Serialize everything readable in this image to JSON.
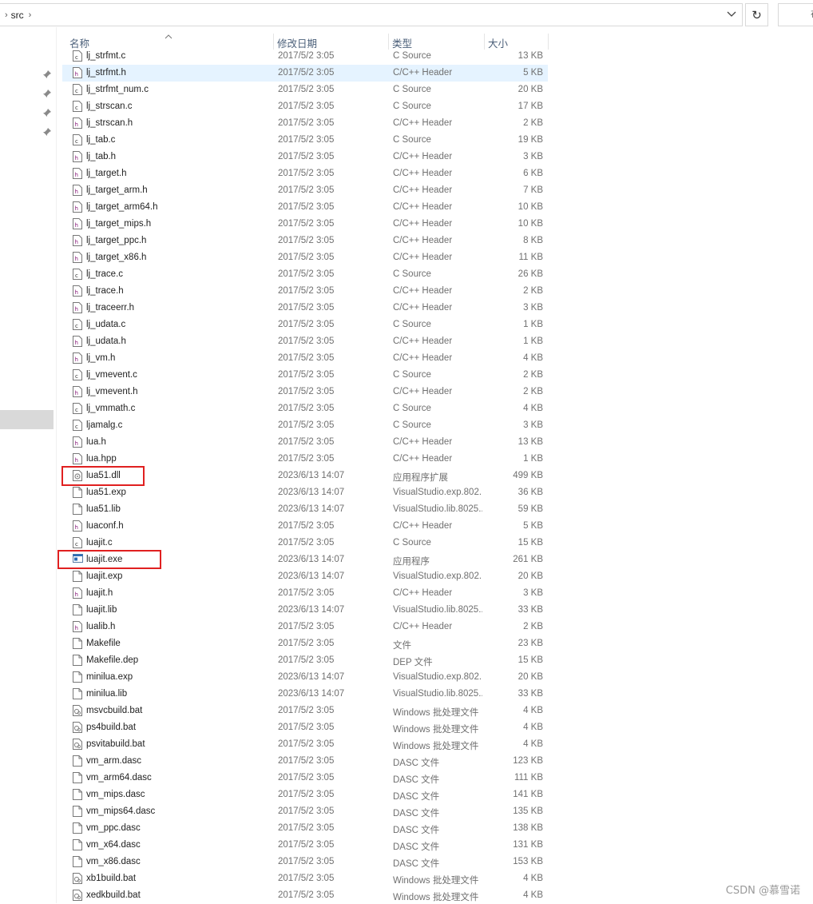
{
  "address": {
    "crumbs": [
      "src"
    ]
  },
  "refresh_label": "↻",
  "search_partial": "在",
  "columns": {
    "name": "名称",
    "date": "修改日期",
    "type": "类型",
    "size": "大小"
  },
  "files": [
    {
      "name": "lj_strfmt.c",
      "date": "2017/5/2 3:05",
      "type": "C Source",
      "size": "13 KB",
      "icon": "c-file-icon"
    },
    {
      "name": "lj_strfmt.h",
      "date": "2017/5/2 3:05",
      "type": "C/C++ Header",
      "size": "5 KB",
      "icon": "h-file-icon",
      "selected": true
    },
    {
      "name": "lj_strfmt_num.c",
      "date": "2017/5/2 3:05",
      "type": "C Source",
      "size": "20 KB",
      "icon": "c-file-icon"
    },
    {
      "name": "lj_strscan.c",
      "date": "2017/5/2 3:05",
      "type": "C Source",
      "size": "17 KB",
      "icon": "c-file-icon"
    },
    {
      "name": "lj_strscan.h",
      "date": "2017/5/2 3:05",
      "type": "C/C++ Header",
      "size": "2 KB",
      "icon": "h-file-icon"
    },
    {
      "name": "lj_tab.c",
      "date": "2017/5/2 3:05",
      "type": "C Source",
      "size": "19 KB",
      "icon": "c-file-icon"
    },
    {
      "name": "lj_tab.h",
      "date": "2017/5/2 3:05",
      "type": "C/C++ Header",
      "size": "3 KB",
      "icon": "h-file-icon"
    },
    {
      "name": "lj_target.h",
      "date": "2017/5/2 3:05",
      "type": "C/C++ Header",
      "size": "6 KB",
      "icon": "h-file-icon"
    },
    {
      "name": "lj_target_arm.h",
      "date": "2017/5/2 3:05",
      "type": "C/C++ Header",
      "size": "7 KB",
      "icon": "h-file-icon"
    },
    {
      "name": "lj_target_arm64.h",
      "date": "2017/5/2 3:05",
      "type": "C/C++ Header",
      "size": "10 KB",
      "icon": "h-file-icon"
    },
    {
      "name": "lj_target_mips.h",
      "date": "2017/5/2 3:05",
      "type": "C/C++ Header",
      "size": "10 KB",
      "icon": "h-file-icon"
    },
    {
      "name": "lj_target_ppc.h",
      "date": "2017/5/2 3:05",
      "type": "C/C++ Header",
      "size": "8 KB",
      "icon": "h-file-icon"
    },
    {
      "name": "lj_target_x86.h",
      "date": "2017/5/2 3:05",
      "type": "C/C++ Header",
      "size": "11 KB",
      "icon": "h-file-icon"
    },
    {
      "name": "lj_trace.c",
      "date": "2017/5/2 3:05",
      "type": "C Source",
      "size": "26 KB",
      "icon": "c-file-icon"
    },
    {
      "name": "lj_trace.h",
      "date": "2017/5/2 3:05",
      "type": "C/C++ Header",
      "size": "2 KB",
      "icon": "h-file-icon"
    },
    {
      "name": "lj_traceerr.h",
      "date": "2017/5/2 3:05",
      "type": "C/C++ Header",
      "size": "3 KB",
      "icon": "h-file-icon"
    },
    {
      "name": "lj_udata.c",
      "date": "2017/5/2 3:05",
      "type": "C Source",
      "size": "1 KB",
      "icon": "c-file-icon"
    },
    {
      "name": "lj_udata.h",
      "date": "2017/5/2 3:05",
      "type": "C/C++ Header",
      "size": "1 KB",
      "icon": "h-file-icon"
    },
    {
      "name": "lj_vm.h",
      "date": "2017/5/2 3:05",
      "type": "C/C++ Header",
      "size": "4 KB",
      "icon": "h-file-icon"
    },
    {
      "name": "lj_vmevent.c",
      "date": "2017/5/2 3:05",
      "type": "C Source",
      "size": "2 KB",
      "icon": "c-file-icon"
    },
    {
      "name": "lj_vmevent.h",
      "date": "2017/5/2 3:05",
      "type": "C/C++ Header",
      "size": "2 KB",
      "icon": "h-file-icon"
    },
    {
      "name": "lj_vmmath.c",
      "date": "2017/5/2 3:05",
      "type": "C Source",
      "size": "4 KB",
      "icon": "c-file-icon"
    },
    {
      "name": "ljamalg.c",
      "date": "2017/5/2 3:05",
      "type": "C Source",
      "size": "3 KB",
      "icon": "c-file-icon"
    },
    {
      "name": "lua.h",
      "date": "2017/5/2 3:05",
      "type": "C/C++ Header",
      "size": "13 KB",
      "icon": "h-file-icon"
    },
    {
      "name": "lua.hpp",
      "date": "2017/5/2 3:05",
      "type": "C/C++ Header",
      "size": "1 KB",
      "icon": "h-file-icon"
    },
    {
      "name": "lua51.dll",
      "date": "2023/6/13 14:07",
      "type": "应用程序扩展",
      "size": "499 KB",
      "icon": "dll-file-icon"
    },
    {
      "name": "lua51.exp",
      "date": "2023/6/13 14:07",
      "type": "VisualStudio.exp.802...",
      "size": "36 KB",
      "icon": "blank-file-icon"
    },
    {
      "name": "lua51.lib",
      "date": "2023/6/13 14:07",
      "type": "VisualStudio.lib.8025...",
      "size": "59 KB",
      "icon": "blank-file-icon"
    },
    {
      "name": "luaconf.h",
      "date": "2017/5/2 3:05",
      "type": "C/C++ Header",
      "size": "5 KB",
      "icon": "h-file-icon"
    },
    {
      "name": "luajit.c",
      "date": "2017/5/2 3:05",
      "type": "C Source",
      "size": "15 KB",
      "icon": "c-file-icon"
    },
    {
      "name": "luajit.exe",
      "date": "2023/6/13 14:07",
      "type": "应用程序",
      "size": "261 KB",
      "icon": "exe-file-icon"
    },
    {
      "name": "luajit.exp",
      "date": "2023/6/13 14:07",
      "type": "VisualStudio.exp.802...",
      "size": "20 KB",
      "icon": "blank-file-icon"
    },
    {
      "name": "luajit.h",
      "date": "2017/5/2 3:05",
      "type": "C/C++ Header",
      "size": "3 KB",
      "icon": "h-file-icon"
    },
    {
      "name": "luajit.lib",
      "date": "2023/6/13 14:07",
      "type": "VisualStudio.lib.8025...",
      "size": "33 KB",
      "icon": "blank-file-icon"
    },
    {
      "name": "lualib.h",
      "date": "2017/5/2 3:05",
      "type": "C/C++ Header",
      "size": "2 KB",
      "icon": "h-file-icon"
    },
    {
      "name": "Makefile",
      "date": "2017/5/2 3:05",
      "type": "文件",
      "size": "23 KB",
      "icon": "blank-file-icon"
    },
    {
      "name": "Makefile.dep",
      "date": "2017/5/2 3:05",
      "type": "DEP 文件",
      "size": "15 KB",
      "icon": "blank-file-icon"
    },
    {
      "name": "minilua.exp",
      "date": "2023/6/13 14:07",
      "type": "VisualStudio.exp.802...",
      "size": "20 KB",
      "icon": "blank-file-icon"
    },
    {
      "name": "minilua.lib",
      "date": "2023/6/13 14:07",
      "type": "VisualStudio.lib.8025...",
      "size": "33 KB",
      "icon": "blank-file-icon"
    },
    {
      "name": "msvcbuild.bat",
      "date": "2017/5/2 3:05",
      "type": "Windows 批处理文件",
      "size": "4 KB",
      "icon": "bat-file-icon"
    },
    {
      "name": "ps4build.bat",
      "date": "2017/5/2 3:05",
      "type": "Windows 批处理文件",
      "size": "4 KB",
      "icon": "bat-file-icon"
    },
    {
      "name": "psvitabuild.bat",
      "date": "2017/5/2 3:05",
      "type": "Windows 批处理文件",
      "size": "4 KB",
      "icon": "bat-file-icon"
    },
    {
      "name": "vm_arm.dasc",
      "date": "2017/5/2 3:05",
      "type": "DASC 文件",
      "size": "123 KB",
      "icon": "blank-file-icon"
    },
    {
      "name": "vm_arm64.dasc",
      "date": "2017/5/2 3:05",
      "type": "DASC 文件",
      "size": "111 KB",
      "icon": "blank-file-icon"
    },
    {
      "name": "vm_mips.dasc",
      "date": "2017/5/2 3:05",
      "type": "DASC 文件",
      "size": "141 KB",
      "icon": "blank-file-icon"
    },
    {
      "name": "vm_mips64.dasc",
      "date": "2017/5/2 3:05",
      "type": "DASC 文件",
      "size": "135 KB",
      "icon": "blank-file-icon"
    },
    {
      "name": "vm_ppc.dasc",
      "date": "2017/5/2 3:05",
      "type": "DASC 文件",
      "size": "138 KB",
      "icon": "blank-file-icon"
    },
    {
      "name": "vm_x64.dasc",
      "date": "2017/5/2 3:05",
      "type": "DASC 文件",
      "size": "131 KB",
      "icon": "blank-file-icon"
    },
    {
      "name": "vm_x86.dasc",
      "date": "2017/5/2 3:05",
      "type": "DASC 文件",
      "size": "153 KB",
      "icon": "blank-file-icon"
    },
    {
      "name": "xb1build.bat",
      "date": "2017/5/2 3:05",
      "type": "Windows 批处理文件",
      "size": "4 KB",
      "icon": "bat-file-icon"
    },
    {
      "name": "xedkbuild.bat",
      "date": "2017/5/2 3:05",
      "type": "Windows 批处理文件",
      "size": "4 KB",
      "icon": "bat-file-icon"
    }
  ],
  "watermark": "CSDN @慕雪诺",
  "colors": {
    "selected_row": "#e5f3ff",
    "annotation_red": "#e02020",
    "header_text": "#4c607a"
  }
}
